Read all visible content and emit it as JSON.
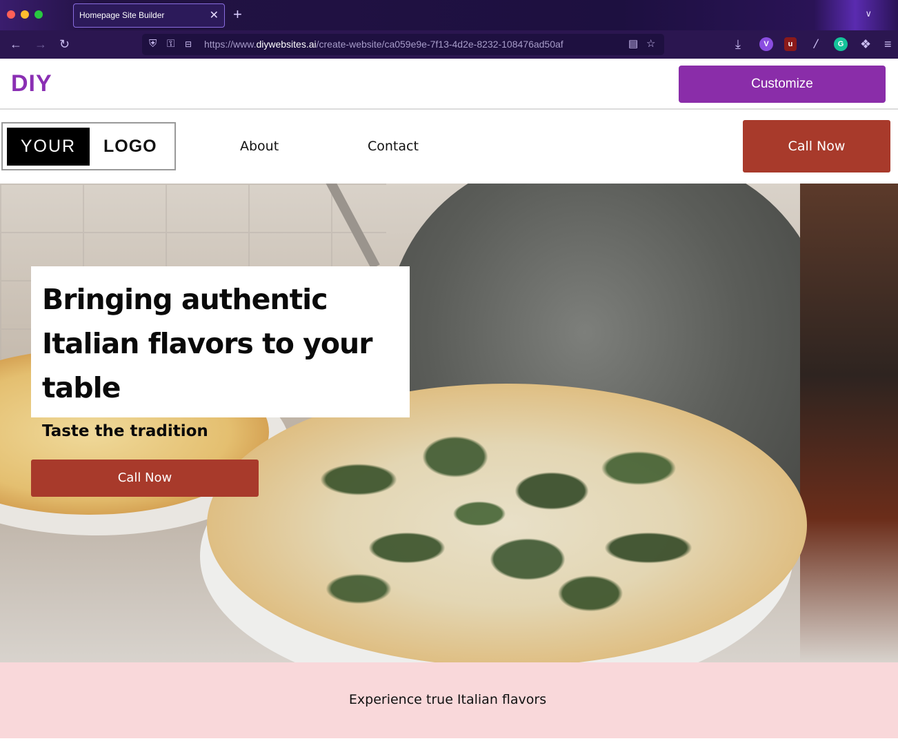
{
  "browser": {
    "tab_title": "Homepage Site Builder",
    "tab_close_icon": "close-icon",
    "new_tab_icon": "plus-icon",
    "url_prefix": "https://www.",
    "url_domain": "diywebsites.ai",
    "url_path": "/create-website/ca059e9e-7f13-4d2e-8232-108476ad50af",
    "back_icon": "←",
    "forward_icon": "→",
    "reload_icon": "↻",
    "shield_icon": "⛨",
    "lock_icon": "⚿",
    "reader_icon": "▤",
    "star_icon": "☆",
    "download_icon": "⤓",
    "menu_icon": "≡",
    "plus_glyph": "+",
    "close_glyph": "✕",
    "chevron_glyph": "∨"
  },
  "builder": {
    "logo": "DIY",
    "customize_label": "Customize",
    "accent_color": "#8a2da9"
  },
  "site": {
    "logo_left": "YOUR",
    "logo_right": "LOGO",
    "nav": [
      "About",
      "Contact"
    ],
    "call_label": "Call Now",
    "call_color": "#a83a2b"
  },
  "hero": {
    "title": "Bringing authentic Italian flavors to your table",
    "subtitle": "Taste the tradition",
    "cta_label": "Call Now"
  },
  "band": {
    "text": "Experience true Italian flavors",
    "color": "#f9d8da"
  }
}
